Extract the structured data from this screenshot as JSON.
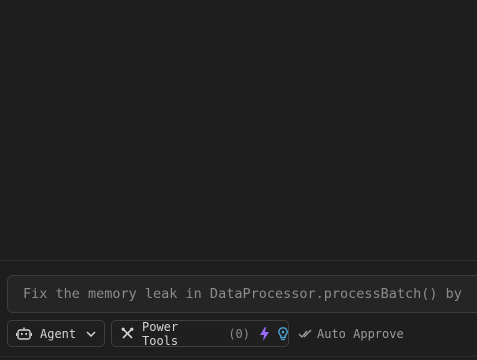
{
  "composer": {
    "placeholder": "Fix the memory leak in DataProcessor.processBatch() by"
  },
  "toolbar": {
    "agent_label": "Agent",
    "tools_label": "Power Tools",
    "tools_count": "(0)",
    "auto_approve_label": "Auto Approve"
  },
  "icons": {
    "agent": "robot-icon",
    "agent_dropdown": "chevron-down-icon",
    "tools": "tools-icon",
    "bolt": "lightning-icon",
    "bulb": "lightbulb-icon",
    "auto": "double-check-icon"
  },
  "colors": {
    "background": "#1e1e1e",
    "bolt": "#9b6bff",
    "bulb": "#4aa3d8"
  }
}
